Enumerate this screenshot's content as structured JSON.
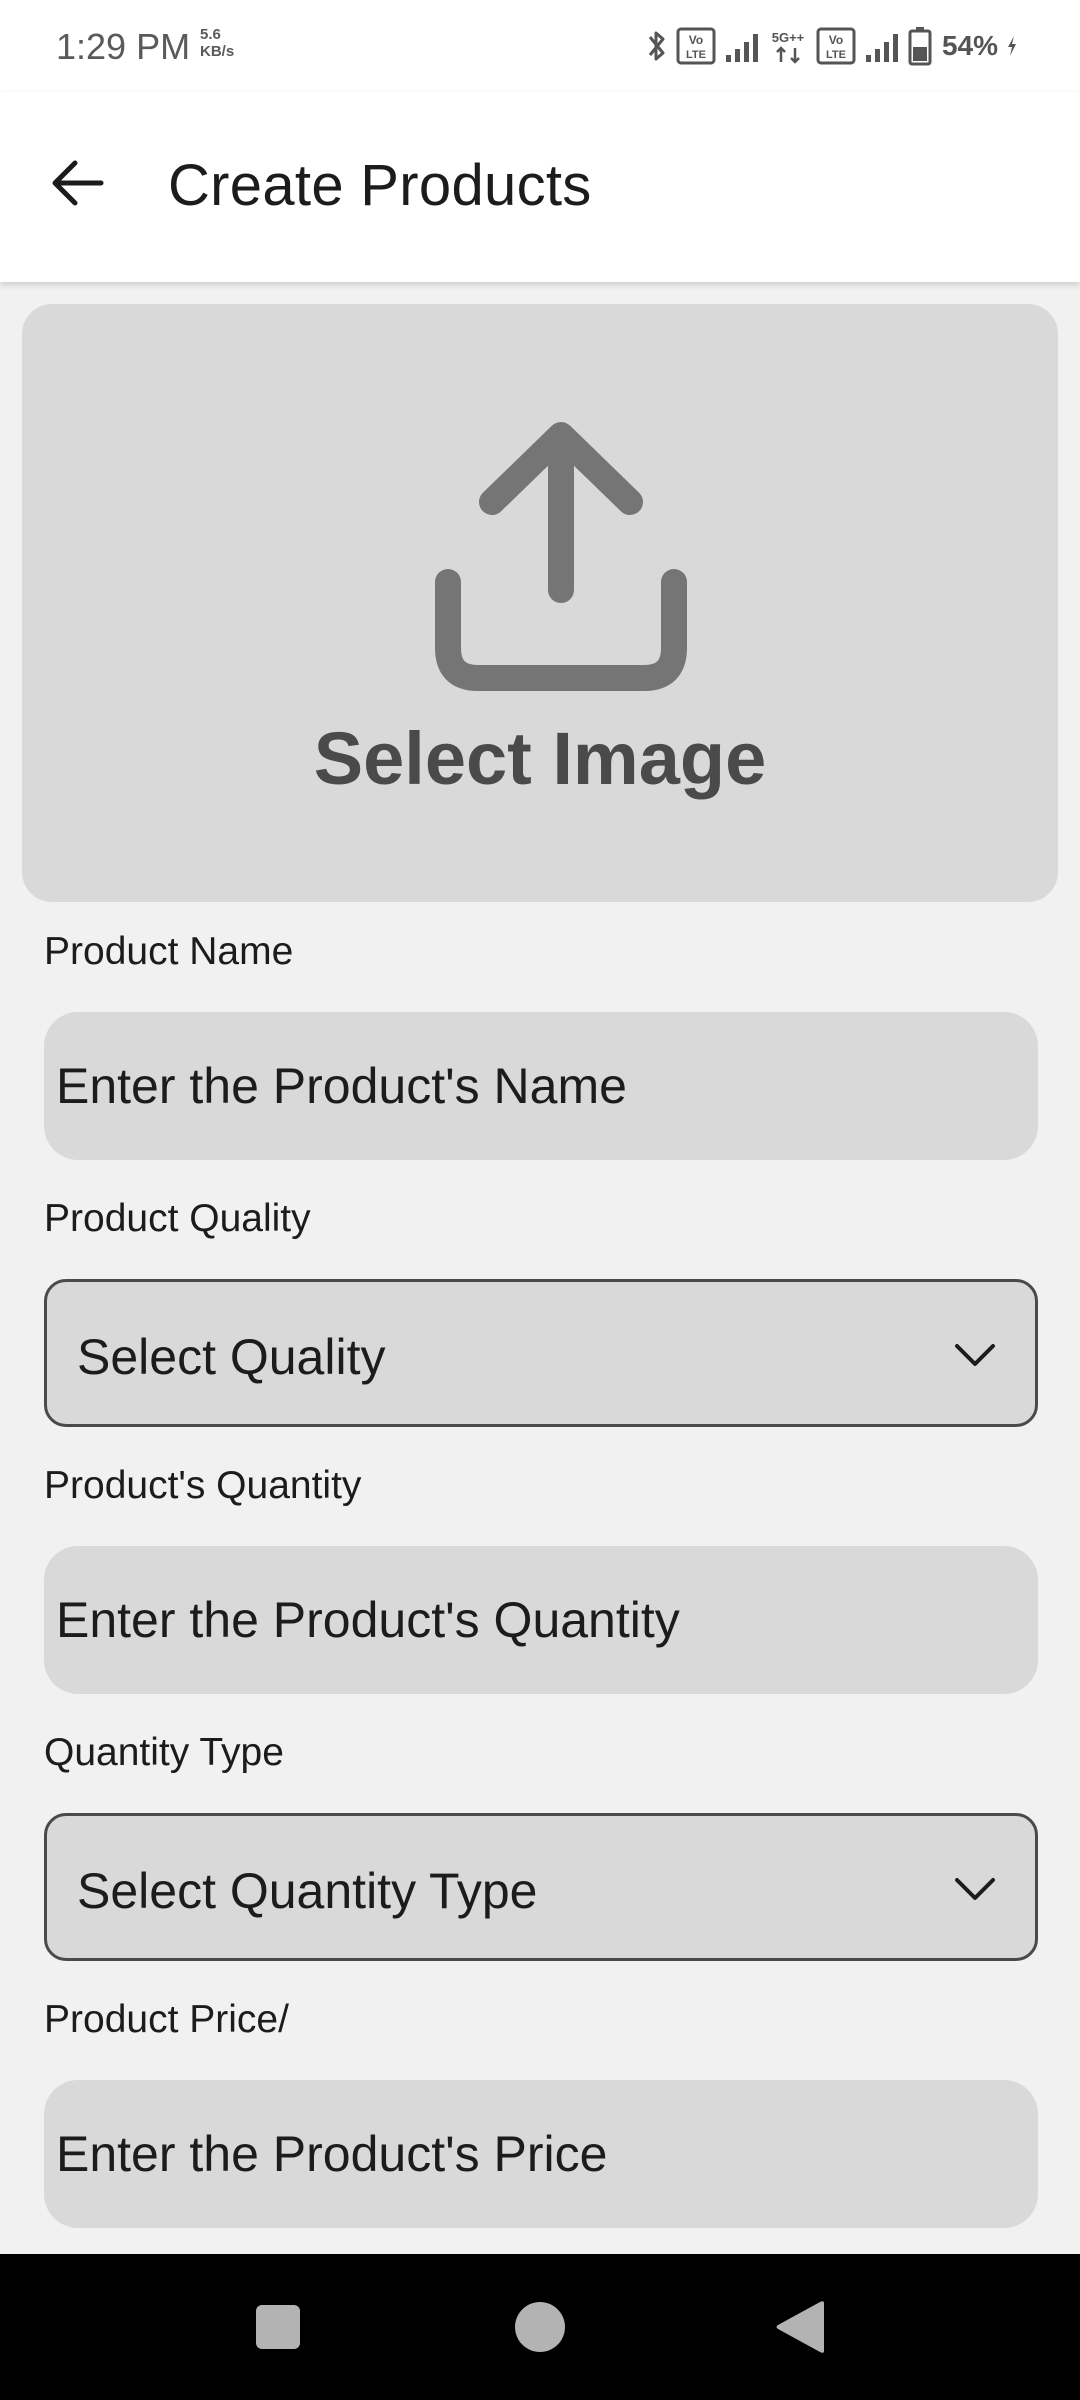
{
  "status_bar": {
    "time": "1:29 PM",
    "speed_value": "5.6",
    "speed_unit": "KB/s",
    "network": "5G++",
    "battery": "54%"
  },
  "app_bar": {
    "title": "Create Products"
  },
  "image_picker": {
    "label": "Select Image",
    "icon": "upload-icon"
  },
  "form": {
    "product_name": {
      "label": "Product Name",
      "placeholder": "Enter the Product's Name",
      "value": ""
    },
    "product_quality": {
      "label": "Product Quality",
      "selected": "Select Quality"
    },
    "product_quantity": {
      "label": "Product's Quantity",
      "placeholder": "Enter the Product's Quantity",
      "value": ""
    },
    "quantity_type": {
      "label": "Quantity Type",
      "selected": "Select Quantity Type"
    },
    "product_price": {
      "label": "Product Price/",
      "placeholder": "Enter the Product's Price",
      "value": ""
    }
  },
  "nav_bar": {
    "icons": [
      "recents-icon",
      "home-icon",
      "back-icon"
    ]
  },
  "colors": {
    "background": "#f1f1f1",
    "field_fill": "#d9d9d9",
    "icon_gray": "#757575",
    "text": "#1c1c1c"
  }
}
